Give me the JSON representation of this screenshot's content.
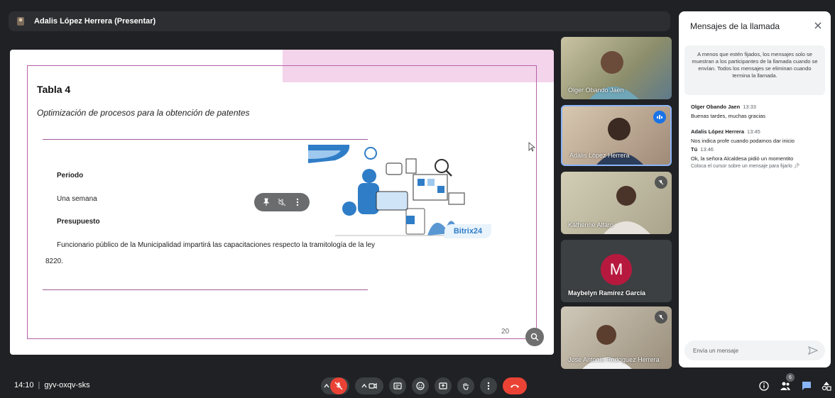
{
  "presenter": {
    "name": "Adalis López Herrera (Presentar)"
  },
  "slide": {
    "title": "Tabla 4",
    "subtitle": "Optimización de procesos para la obtención de patentes",
    "periodo_label": "Periodo",
    "periodo_value": "Una semana",
    "presupuesto_label": "Presupuesto",
    "body_line1": "Funcionario público de la Municipalidad impartirá las capacitaciones respecto la tramitología de la ley",
    "body_line2": "8220.",
    "brand": "Bitrix24",
    "page_number": "20"
  },
  "participants": [
    {
      "name": "Olger Obando Jaen"
    },
    {
      "name": "Adalis López Herrera"
    },
    {
      "name": "Katherine Alfaro"
    },
    {
      "name": "Maybelyn Ramírez García",
      "initial": "M"
    },
    {
      "name": "Jose Antonio Rodríguez Herrera"
    }
  ],
  "chat": {
    "title": "Mensajes de la llamada",
    "info": "A menos que estén fijados, los mensajes solo se muestran a los participantes de la llamada cuando se envían. Todos los mensajes se eliminan cuando termina la llamada.",
    "messages": [
      {
        "author": "Olger Obando Jaen",
        "time": "13:33",
        "text": "Buenas tardes, muchas gracias"
      },
      {
        "author": "Adalis López Herrera",
        "time": "13:45",
        "text": "Nos indica profe cuando podamos dar inicio"
      },
      {
        "author": "Tú",
        "time": "13:46",
        "text": "Ok, la señora Alcaldesa pidió un momentito"
      }
    ],
    "pin_hint": "Coloca el cursor sobre un mensaje para fijarlo",
    "input_placeholder": "Envía un mensaje"
  },
  "bottom": {
    "time": "14:10",
    "meeting_code": "gyv-oxqv-sks",
    "people_count": "6"
  },
  "colors": {
    "end_call": "#ea4335",
    "avatar_m": "#b7193e",
    "slide_border": "#b660a8",
    "accent": "#8ab4f8"
  }
}
